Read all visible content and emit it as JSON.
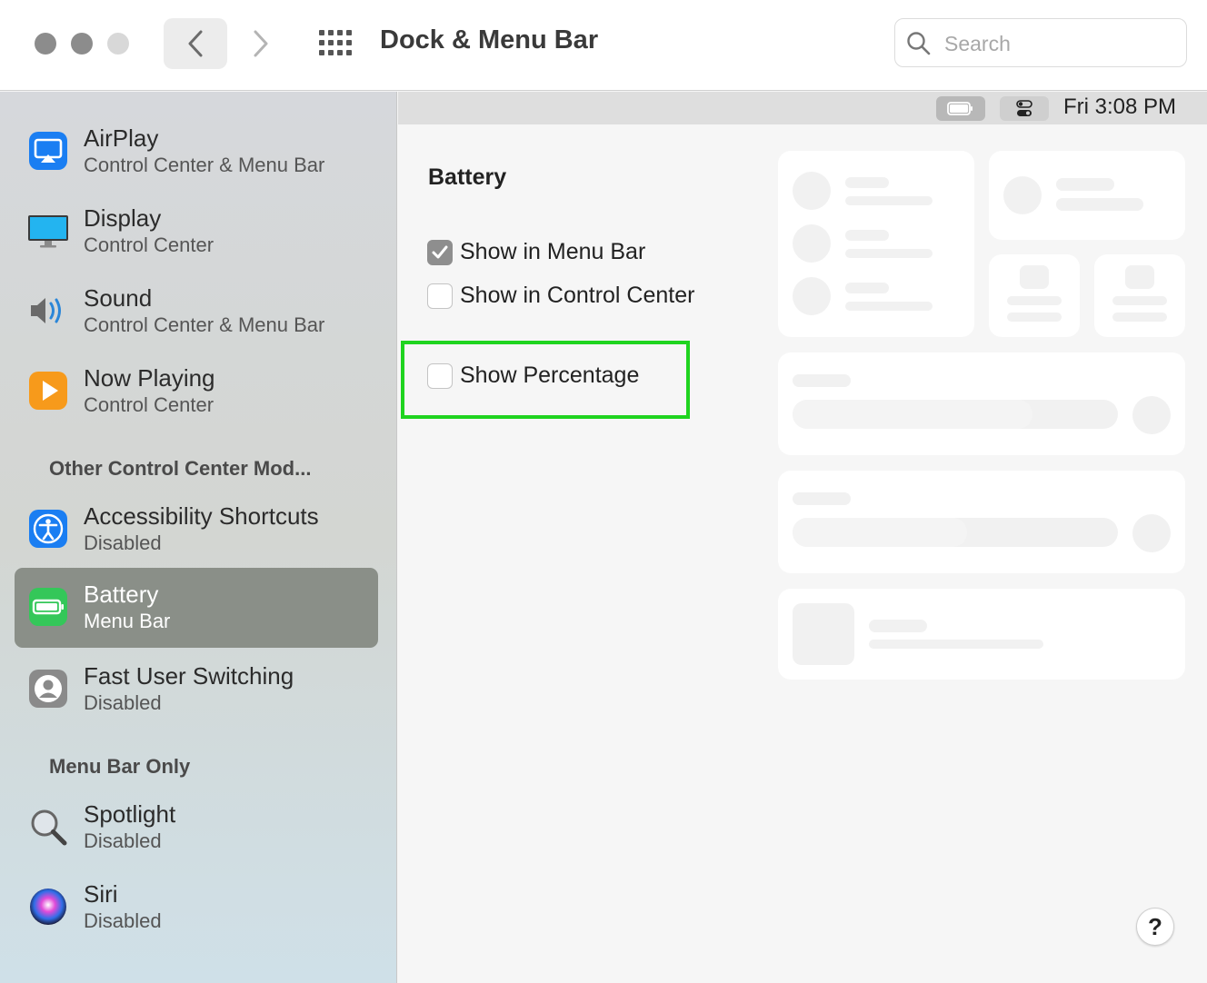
{
  "window": {
    "title": "Dock & Menu Bar"
  },
  "search": {
    "placeholder": "Search",
    "value": ""
  },
  "sidebar": {
    "items": [
      {
        "name": "AirPlay",
        "sub": "Control Center & Menu Bar",
        "icon": "airplay-icon"
      },
      {
        "name": "Display",
        "sub": "Control Center",
        "icon": "display-icon"
      },
      {
        "name": "Sound",
        "sub": "Control Center & Menu Bar",
        "icon": "speaker-icon"
      },
      {
        "name": "Now Playing",
        "sub": "Control Center",
        "icon": "play-icon"
      }
    ],
    "section_other": "Other Control Center Mod...",
    "other_items": [
      {
        "name": "Accessibility Shortcuts",
        "sub": "Disabled",
        "icon": "accessibility-icon"
      },
      {
        "name": "Battery",
        "sub": "Menu Bar",
        "icon": "battery-icon",
        "selected": true
      },
      {
        "name": "Fast User Switching",
        "sub": "Disabled",
        "icon": "user-icon"
      }
    ],
    "section_menubar": "Menu Bar Only",
    "menubar_items": [
      {
        "name": "Spotlight",
        "sub": "Disabled",
        "icon": "spotlight-icon"
      },
      {
        "name": "Siri",
        "sub": "Disabled",
        "icon": "siri-icon"
      }
    ]
  },
  "menubar_preview": {
    "time": "Fri 3:08 PM"
  },
  "battery": {
    "heading": "Battery",
    "options": [
      {
        "label": "Show in Menu Bar",
        "checked": true
      },
      {
        "label": "Show in Control Center",
        "checked": false
      },
      {
        "label": "Show Percentage",
        "checked": false
      }
    ]
  },
  "help": {
    "label": "?"
  },
  "colors": {
    "accent_gray": "#8e8e8e",
    "highlight": "#1fd41f",
    "selected_row": "#8a8f88"
  }
}
